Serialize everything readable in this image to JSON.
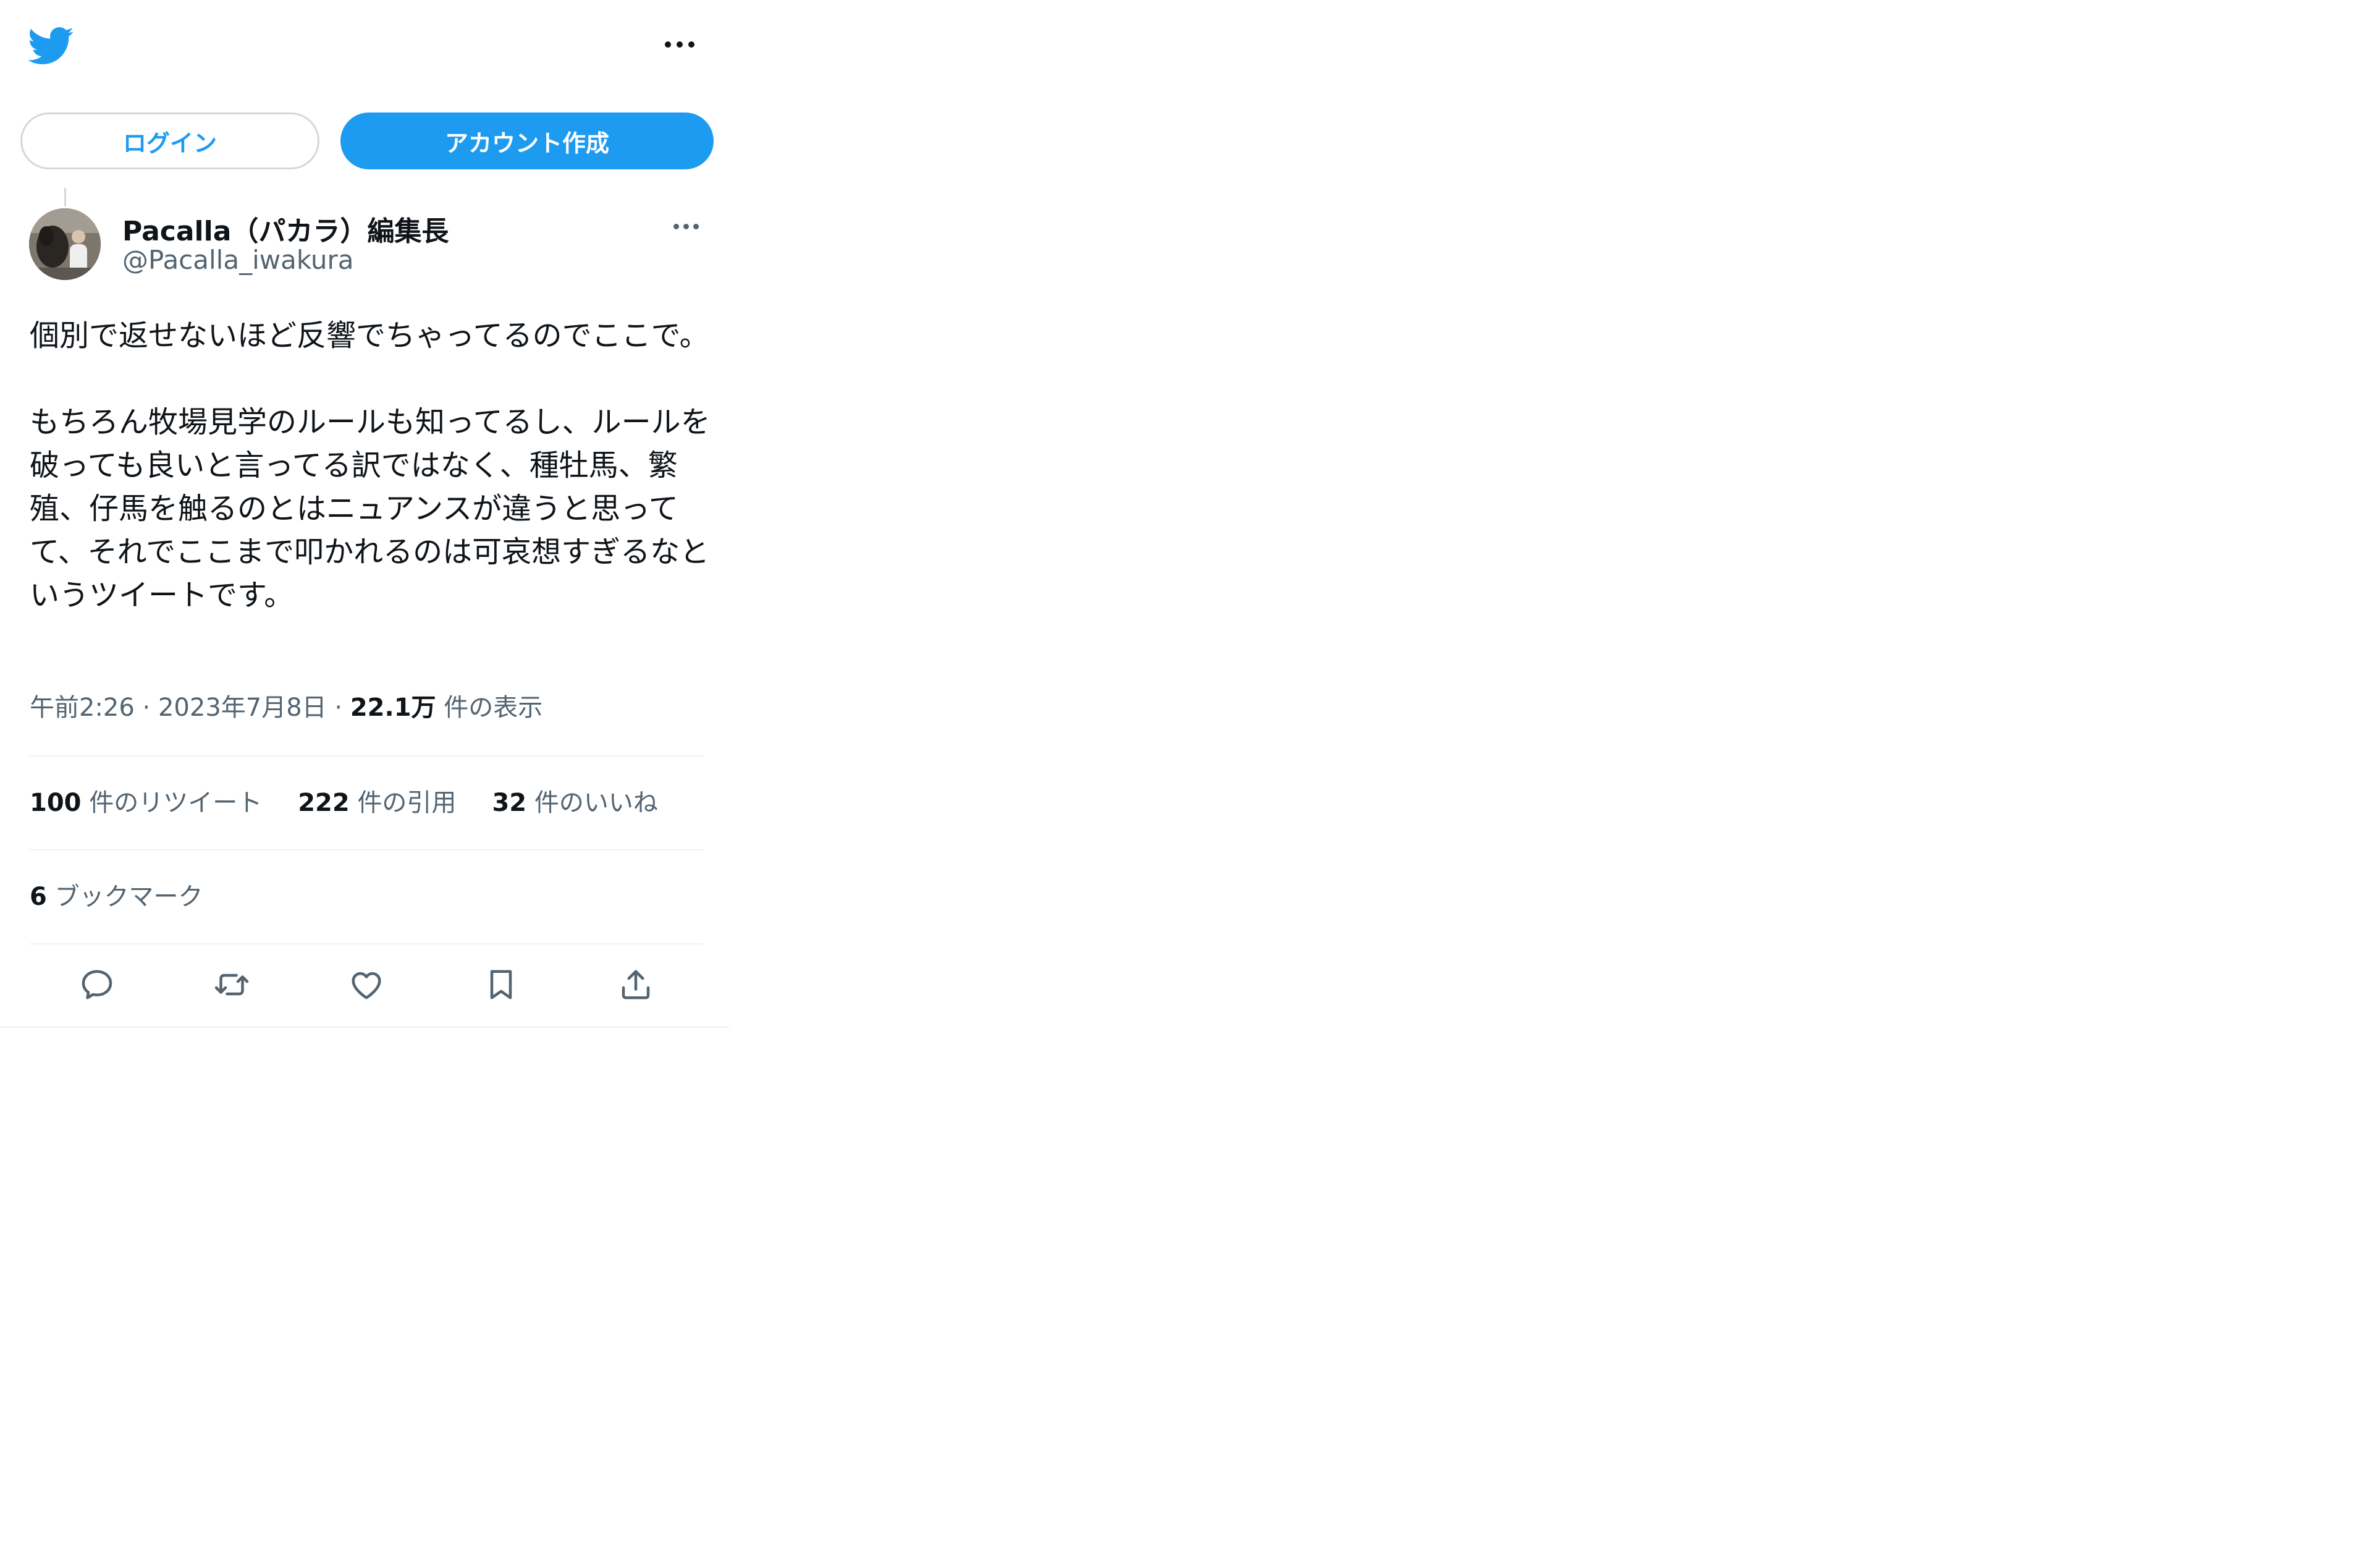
{
  "header": {
    "logo_icon": "twitter-bird-icon",
    "more_icon": "more-horizontal-icon"
  },
  "auth": {
    "login_label": "ログイン",
    "signup_label": "アカウント作成"
  },
  "tweet": {
    "author_name": "Pacalla（パカラ）編集長",
    "author_handle": "@Pacalla_iwakura",
    "text": "個別で返せないほど反響でちゃってるのでここで。\n\nもちろん牧場見学のルールも知ってるし、ルールを破っても良いと言ってる訳ではなく、種牡馬、繁殖、仔馬を触るのとはニュアンスが違うと思ってて、それでここまで叩かれるのは可哀想すぎるなというツイートです。",
    "time": "午前2:26",
    "date": "2023年7月8日",
    "views_count": "22.1万",
    "views_label": "件の表示",
    "retweets_count": "100",
    "retweets_label": "件のリツイート",
    "quotes_count": "222",
    "quotes_label": "件の引用",
    "likes_count": "32",
    "likes_label": "件のいいね",
    "bookmarks_count": "6",
    "bookmarks_label": "ブックマーク"
  },
  "actions": [
    "reply-icon",
    "retweet-icon",
    "like-icon",
    "bookmark-icon",
    "share-icon"
  ],
  "colors": {
    "accent": "#1d9bf0",
    "text": "#0f1419",
    "secondary": "#536471",
    "border": "#cfd9de",
    "divider": "#eff3f4"
  }
}
